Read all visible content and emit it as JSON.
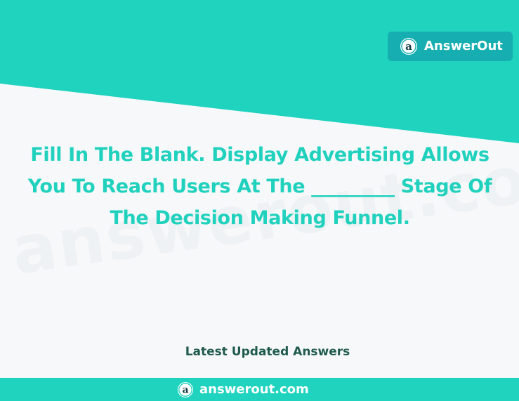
{
  "brand": {
    "name": "AnswerOut",
    "logo_icon": "answerout-logo-icon"
  },
  "watermark": {
    "text": "answerout.com"
  },
  "question": {
    "text": "Fill In The Blank. Display Advertising Allows You To Reach Users At The _________ Stage Of The Decision Making Funnel."
  },
  "section": {
    "label": "Latest Updated Answers"
  },
  "footer": {
    "site": "answerout.com",
    "logo_icon": "answerout-logo-icon"
  },
  "colors": {
    "teal_band": "#1fd3bf",
    "badge_bg": "#16aeb0",
    "question_text": "#20d1bd",
    "section_text": "#1f5a4d",
    "page_bg": "#f7f8fa"
  }
}
